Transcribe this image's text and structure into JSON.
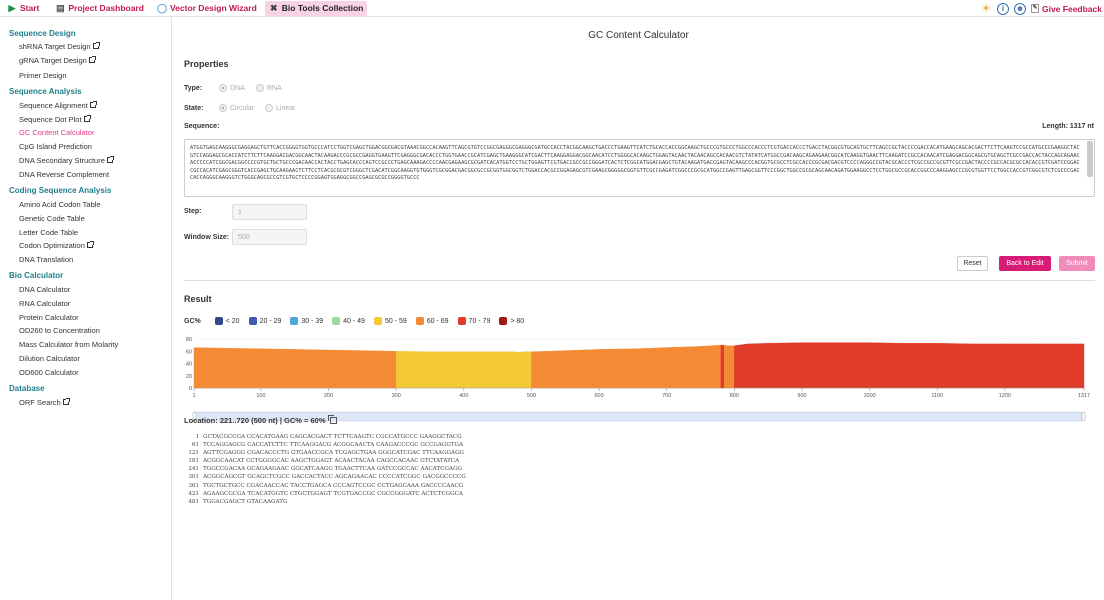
{
  "topbar": {
    "tabs": [
      {
        "label": "Start",
        "icon": "play-icon",
        "active": false
      },
      {
        "label": "Project Dashboard",
        "icon": "dashboard-icon",
        "active": false
      },
      {
        "label": "Vector Design Wizard",
        "icon": "plasmid-icon",
        "active": false
      },
      {
        "label": "Bio Tools Collection",
        "icon": "tools-icon",
        "active": true
      }
    ],
    "feedback": "Give Feedback"
  },
  "sidebar": {
    "sections": [
      {
        "title": "Sequence Design",
        "items": [
          {
            "label": "shRNA Target Design",
            "ext": true
          },
          {
            "label": "gRNA Target Design",
            "ext": true
          },
          {
            "label": "Primer Design",
            "ext": false
          }
        ]
      },
      {
        "title": "Sequence Analysis",
        "items": [
          {
            "label": "Sequence Alignment",
            "ext": true
          },
          {
            "label": "Sequence Dot Plot",
            "ext": true
          },
          {
            "label": "GC Content Calculator",
            "ext": false,
            "active": true
          },
          {
            "label": "CpG Island Prediction",
            "ext": false
          },
          {
            "label": "DNA Secondary Structure",
            "ext": true
          },
          {
            "label": "DNA Reverse Complement",
            "ext": false
          }
        ]
      },
      {
        "title": "Coding Sequence Analysis",
        "items": [
          {
            "label": "Amino Acid Codon Table",
            "ext": false
          },
          {
            "label": "Genetic Code Table",
            "ext": false
          },
          {
            "label": "Letter Code Table",
            "ext": false
          },
          {
            "label": "Codon Optimization",
            "ext": true
          },
          {
            "label": "DNA Translation",
            "ext": false
          }
        ]
      },
      {
        "title": "Bio Calculator",
        "items": [
          {
            "label": "DNA Calculator",
            "ext": false
          },
          {
            "label": "RNA Calculator",
            "ext": false
          },
          {
            "label": "Protein Calculator",
            "ext": false
          },
          {
            "label": "OD260 to Concentration",
            "ext": false
          },
          {
            "label": "Mass Calculator from Molarity",
            "ext": false
          },
          {
            "label": "Dilution Calculator",
            "ext": false
          },
          {
            "label": "OD600 Calculator",
            "ext": false
          }
        ]
      },
      {
        "title": "Database",
        "items": [
          {
            "label": "ORF Search",
            "ext": true
          }
        ]
      }
    ]
  },
  "main": {
    "title": "GC Content Calculator",
    "properties_heading": "Properties",
    "type_label": "Type:",
    "type_options": [
      "DNA",
      "RNA"
    ],
    "state_label": "State:",
    "state_options": [
      "Circular",
      "Linear"
    ],
    "sequence_label": "Sequence:",
    "length_text": "Length: 1317 nt",
    "sequence": "ATGGTGAGCAAGGGCGAGGAGCTGTTCACCGGGGTGGTGCCCATCCTGGTCGAGCTGGACGGCGACGTAAACGGCCACAAGTTCAGCGTGTCCGGCGAGGGCGAGGGCGATGCCACCTACGGCAAGCTGACCCTGAAGTTCATCTGCACCACCGGCAAGCTGCCCGTGCCCTGGCCCACCCTCGTGACCACCCTGACCTACGGCGTGCAGTGCTTCAGCCGCTACCCCGACCACATGAAGCAGCACGACTTCTTCAAGTCCGCCATGCCCGAAGGCTACGTCCAGGAGCGCACCATCTTCTTCAAGGACGACGGCAACTACAAGACCCGCGCCGAGGTGAAGTTCGAGGGCGACACCCTGGTGAACCGCATCGAGCTGAAGGGCATCGACTTCAAGGAGGACGGCAACATCCTGGGGCACAAGCTGGAGTACAACTACAACAGCCACAACGTCTATATCATGGCCGACAAGCAGAAGAACGGCATCAAGGTGAACTTCAAGATCCGCCACAACATCGAGGACGGCAGCGTGCAGCTCGCCGACCACTACCAGCAGAACACCCCCATCGGCGACGGCCCCGTGCTGCTGCCCGACAACCACTACCTGAGCACCCAGTCCGCCCTGAGCAAAGACCCCAACGAGAAGCGCGATCACATGGTCCTGCTGGAGTTCGTGACCGCCGCCGGGATCACTCTCGGCATGGACGAGCTGTACAAGATGACCGAGTACAAGCCCACGGTGCGCCTCGCCACCCGCGACGACGTCCCCAGGGCCGTACGCACCCTCGCCGCCGCGTTCGCCGACTACCCCGCCACGCGCCACACCGTCGATCCGGACCGCCACATCGAGCGGGTCACCGAGCTGCAAGAACTCTTCCTCACGCGCGTCGGGCTCGACATCGGCAAGGTGTGGGTCGCGGACGACGGCGCCGCGGTGGCGGTCTGGACCACGCCGGAGAGCGTCGAAGCGGGGGCGGTGTTCGCCGAGATCGGCCCGCGCATGGCCGAGTTGAGCGGTTCCCGGCTGGCCGCGCAGCAACAGATGGAAGGCCTCCTGGCGCCGCACCGGCCCAAGGAGCCCGCGTGGTTCCTGGCCACCGTCGGCGTCTCGCCCGACCACCAGGGCAAGGGTCTGGGCAGCGCCGTCGTGCTCCCCGGAGTGGAGGCGGCCGAGCGCGCCGGGGTGCCC",
    "step_label": "Step:",
    "step_value": "1",
    "window_label": "Window Size:",
    "window_value": "500",
    "btn_reset": "Reset",
    "btn_back": "Back to Edit",
    "btn_submit": "Submit",
    "result_heading": "Result",
    "legend_title": "GC%",
    "location_text": "Location: 221..720 (500 nt) | GC% = 60%"
  },
  "legend": [
    {
      "label": "< 20",
      "color": "#2f4a8a"
    },
    {
      "label": "20 - 29",
      "color": "#3a5fb0"
    },
    {
      "label": "30 - 39",
      "color": "#4fa6dc"
    },
    {
      "label": "40 - 49",
      "color": "#9fd79f"
    },
    {
      "label": "50 - 59",
      "color": "#f5c836"
    },
    {
      "label": "60 - 69",
      "color": "#f58a34"
    },
    {
      "label": "70 - 79",
      "color": "#e03a2a"
    },
    {
      "label": "> 80",
      "color": "#a01818"
    }
  ],
  "chart_data": {
    "type": "area",
    "ylim": [
      0,
      80
    ],
    "yticks": [
      0,
      20,
      40,
      60,
      80
    ],
    "xlim": [
      1,
      1317
    ],
    "xticks": [
      1,
      100,
      200,
      300,
      400,
      500,
      600,
      700,
      800,
      900,
      1000,
      1100,
      1200,
      1317
    ],
    "series": [
      {
        "x": [
          1,
          50,
          100,
          150,
          200,
          250,
          300,
          350,
          400,
          450,
          475,
          480,
          490,
          500,
          550,
          600,
          650,
          700,
          750,
          780,
          785,
          790,
          800,
          820,
          850,
          900,
          950,
          1000,
          1050,
          1100,
          1150,
          1200,
          1250,
          1300,
          1317
        ],
        "values": [
          66,
          65,
          64,
          63,
          62,
          61,
          60,
          59,
          59,
          59,
          59,
          58,
          59,
          59,
          61,
          63,
          64,
          66,
          68,
          70,
          70,
          69,
          69,
          72,
          73,
          74,
          74,
          74,
          73,
          73,
          72,
          72,
          72,
          72,
          72
        ]
      }
    ]
  },
  "seqview": [
    {
      "n": "1",
      "t": "GCTACGCCGA CCACATGAAG CAGCACGACT TCTTCAAGTC CGCCATGCCC GAAGGCTACG"
    },
    {
      "n": "61",
      "t": "TCCAGGAGCG CACCATCTTC TTCAAGGACG ACGGCAACTA CAAGACCCGC GCCGAGGTGA"
    },
    {
      "n": "121",
      "t": "AGTTCGAGGG CGACACCCTG GTGAACCGCA TCGAGCTGAA GGGCATCGAC TTCAAGGAGG"
    },
    {
      "n": "181",
      "t": "ACGGCAACAT CCTGGGGCAC AAGCTGGAGT ACAACTACAA CAGCCACAAC GTCTATATCA"
    },
    {
      "n": "241",
      "t": "TGGCCGACAA GCAGAAGAAC GGCATCAAGG TGAACTTCAA GATCCGCCAC AACATCGAGG"
    },
    {
      "n": "301",
      "t": "ACGGCAGCGT GCAGCTCGCC GACCACTACC AGCAGAACAC CCCCATCGGC GACGGCCCCG"
    },
    {
      "n": "361",
      "t": "TGCTGCTGCC CGACAACCAC TACCTGAGCA CCCAGTCCGC CCTGAGCAAA GACCCCAACG"
    },
    {
      "n": "421",
      "t": "AGAAGCGCGA TCACATGGTC CTGCTGGAGT TCGTGACCGC CGCCGGGATC ACTCTCGGCA"
    },
    {
      "n": "481",
      "t": "TGGACGAGCT GTACAAGATG"
    }
  ]
}
